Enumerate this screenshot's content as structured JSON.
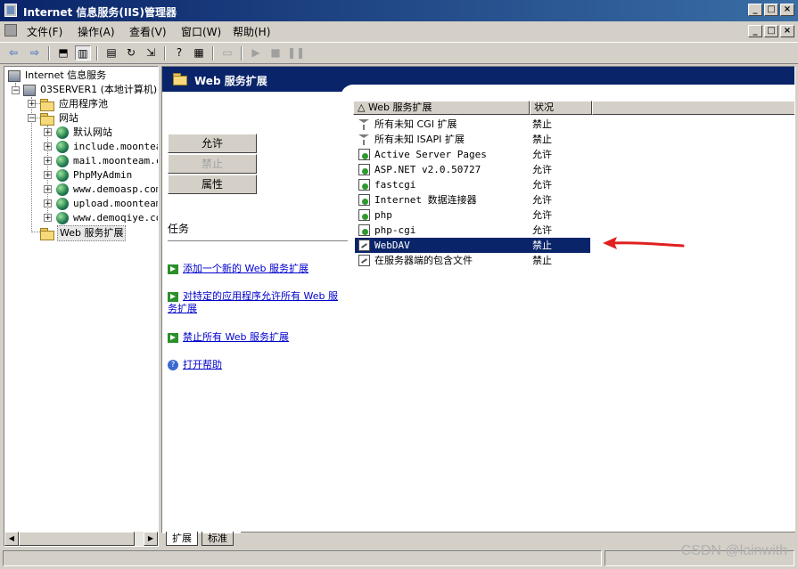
{
  "window": {
    "title": "Internet 信息服务(IIS)管理器",
    "min": "_",
    "max": "□",
    "close": "×"
  },
  "menubar": {
    "items": [
      "文件(F)",
      "操作(A)",
      "查看(V)",
      "窗口(W)",
      "帮助(H)"
    ]
  },
  "tree": {
    "root": "Internet 信息服务",
    "server": "03SERVER1 (本地计算机)",
    "app_pools": "应用程序池",
    "websites": "网站",
    "sites": [
      "默认网站",
      "include.moontea",
      "mail.moonteam.c",
      "PhpMyAdmin",
      "www.demoasp.com",
      "upload.moonteam",
      "www.demoqiye.co"
    ],
    "web_ext": "Web 服务扩展"
  },
  "panel": {
    "title": "Web 服务扩展",
    "btn_allow": "允许",
    "btn_prohibit": "禁止",
    "btn_properties": "属性",
    "tasks_title": "任务",
    "task_add": "添加一个新的 Web 服务扩展",
    "task_allow_app": "对特定的应用程序允许所有 Web 服务扩展",
    "task_prohibit_all": "禁止所有 Web 服务扩展",
    "task_help": "打开帮助"
  },
  "list": {
    "col_name": "Web 服务扩展",
    "col_status": "状况",
    "rows": [
      {
        "icon": "filter-icon",
        "name": "所有未知 CGI 扩展",
        "status": "禁止"
      },
      {
        "icon": "filter-icon",
        "name": "所有未知 ISAPI 扩展",
        "status": "禁止"
      },
      {
        "icon": "allowed-icon",
        "name": "Active Server Pages",
        "status": "允许"
      },
      {
        "icon": "allowed-icon",
        "name": "ASP.NET v2.0.50727",
        "status": "允许"
      },
      {
        "icon": "allowed-icon",
        "name": "fastcgi",
        "status": "允许"
      },
      {
        "icon": "allowed-icon",
        "name": "Internet 数据连接器",
        "status": "允许"
      },
      {
        "icon": "allowed-icon",
        "name": "php",
        "status": "允许"
      },
      {
        "icon": "allowed-icon",
        "name": "php-cgi",
        "status": "允许"
      },
      {
        "icon": "prohibited-icon",
        "name": "WebDAV",
        "status": "禁止",
        "selected": true
      },
      {
        "icon": "prohibited-icon",
        "name": "在服务器端的包含文件",
        "status": "禁止"
      }
    ]
  },
  "tabs": {
    "extended": "扩展",
    "standard": "标准"
  },
  "watermark": "CSDN @lainwith",
  "colors": {
    "selection": "#0a246a",
    "arrow": "#e02020"
  }
}
